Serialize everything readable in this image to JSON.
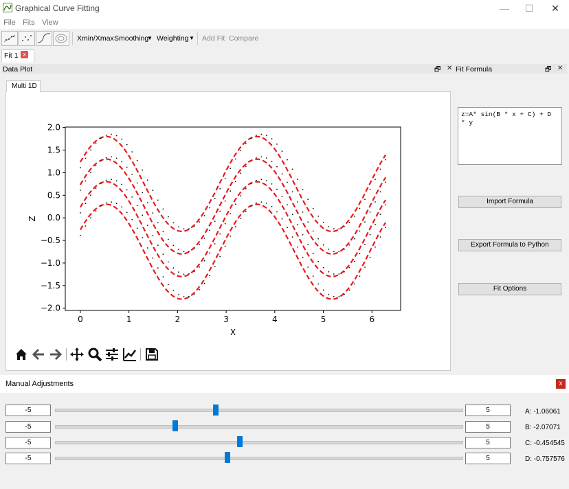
{
  "window": {
    "title": "Graphical Curve Fitting",
    "minimize": "—",
    "maximize": "☐",
    "close": "✕"
  },
  "menu": [
    "File",
    "Fits",
    "View"
  ],
  "toolbar": {
    "xminmax": "Xmin/Xmax",
    "smoothing": "Smoothing",
    "weighting": "Weighting",
    "add_fit": "Add Fit",
    "compare": "Compare",
    "dropdown": "▼"
  },
  "tabs": {
    "fit1": "Fit 1",
    "close": "x"
  },
  "data_plot": {
    "title": "Data Plot",
    "subtab": "Multi 1D",
    "float": "🗗",
    "close": "✕"
  },
  "fit_formula": {
    "title": "Fit Formula",
    "float": "🗗",
    "close": "✕",
    "formula": "z=A* sin(B * x + C) + D\n* y"
  },
  "buttons": {
    "import": "Import Formula",
    "export": "Export Formula to Python",
    "options": "Fit Options"
  },
  "manual": {
    "title": "Manual Adjustments",
    "close": "x",
    "params": [
      {
        "min": "-5",
        "max": "5",
        "label": "A: -1.06061",
        "slider": 0.396
      },
      {
        "min": "-5",
        "max": "5",
        "label": "B: -2.07071",
        "slider": 0.296
      },
      {
        "min": "-5",
        "max": "5",
        "label": "C: -0.454545",
        "slider": 0.455
      },
      {
        "min": "-5",
        "max": "5",
        "label": "D: -0.757576",
        "slider": 0.424
      }
    ]
  },
  "mpl_toolbar": [
    "home-icon",
    "back-icon",
    "forward-icon",
    "pan-icon",
    "zoom-icon",
    "configure-icon",
    "edit-axis-icon",
    "save-icon"
  ],
  "chart_data": {
    "type": "line",
    "xlabel": "X",
    "ylabel": "Z",
    "xlim": [
      -0.31,
      6.59
    ],
    "ylim": [
      -2.05,
      2.01
    ],
    "xticks": [
      "0",
      "1",
      "2",
      "3",
      "4",
      "5",
      "6"
    ],
    "yticks": [
      "2.0",
      "1.5",
      "1.0",
      "0.5",
      "0.0",
      "−0.5",
      "−1.0",
      "−1.5",
      "−2.0"
    ],
    "grid": false,
    "series": [
      {
        "style": "red-dashed-fit",
        "x_range": [
          0,
          6.28
        ],
        "offsets": [
          0.75,
          0.25,
          -0.25,
          -0.75
        ]
      },
      {
        "style": "black-dotted-data",
        "x_range": [
          0,
          6.28
        ],
        "offsets": [
          0.75,
          0.25,
          -0.25,
          -0.75
        ]
      }
    ]
  }
}
